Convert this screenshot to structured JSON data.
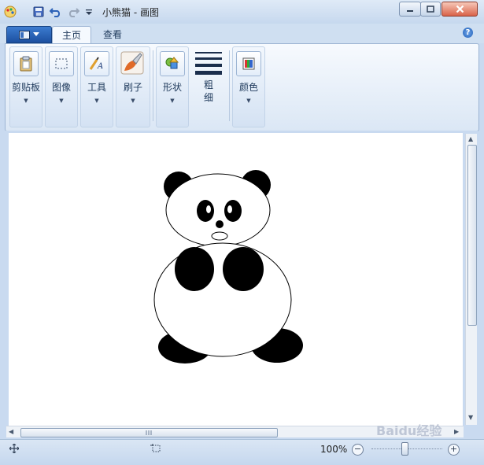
{
  "window": {
    "title": "小熊猫 - 画图",
    "controls": {
      "minimize": "▭",
      "maximize": "□",
      "close": "✕"
    }
  },
  "quick_access": {
    "icons": [
      "paint-app-icon",
      "save-icon",
      "undo-icon",
      "redo-icon",
      "customize-dropdown-icon"
    ]
  },
  "ribbon": {
    "app_menu_icon": "paint-menu-icon",
    "tabs": [
      {
        "label": "主页",
        "active": true
      },
      {
        "label": "查看",
        "active": false
      }
    ],
    "help_label": "?",
    "groups": [
      {
        "label": "剪贴板",
        "icon": "clipboard-icon"
      },
      {
        "label": "图像",
        "icon": "select-image-icon"
      },
      {
        "label": "工具",
        "icon": "tools-icon"
      },
      {
        "label": "刷子",
        "icon": "brush-icon"
      },
      {
        "label": "形状",
        "icon": "shapes-icon"
      },
      {
        "label": "粗\n细",
        "icon": "line-thickness-icon"
      },
      {
        "label": "颜色",
        "icon": "colors-icon"
      }
    ]
  },
  "canvas": {
    "drawing": "panda",
    "colors": {
      "fill_black": "#000000",
      "fill_white": "#ffffff"
    }
  },
  "status": {
    "zoom": "100%",
    "zoom_out": "−",
    "zoom_in": "+"
  },
  "watermark": "Baidu经验"
}
